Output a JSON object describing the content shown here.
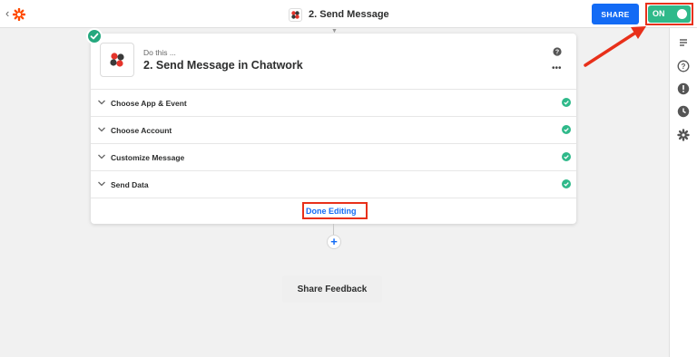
{
  "header": {
    "back_label": "‹",
    "title": "2. Send Message",
    "share_label": "SHARE",
    "toggle_label": "ON"
  },
  "card": {
    "eyebrow": "Do this ...",
    "title": "2. Send Message in Chatwork",
    "help_icon": "question-circle-icon",
    "more_label": "•••",
    "steps": [
      {
        "label": "Choose App & Event"
      },
      {
        "label": "Choose Account"
      },
      {
        "label": "Customize Message"
      },
      {
        "label": "Send Data"
      }
    ],
    "done_label": "Done Editing"
  },
  "add_label": "+",
  "feedback_label": "Share Feedback",
  "sidebar_icons": [
    "details-icon",
    "help-icon",
    "alert-icon",
    "history-icon",
    "settings-icon"
  ],
  "colors": {
    "accent": "#136bf5",
    "success": "#2fb98a",
    "highlight": "#e8301a",
    "zapier_orange": "#ff4a00"
  }
}
